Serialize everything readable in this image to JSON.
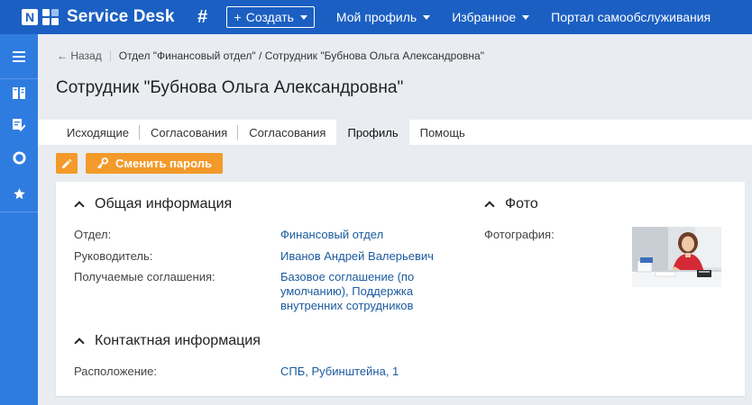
{
  "header": {
    "logo_letter": "N",
    "app_name": "Service Desk",
    "create_label": "Создать",
    "nav": [
      {
        "label": "Мой профиль"
      },
      {
        "label": "Избранное"
      },
      {
        "label": "Портал самообслуживания"
      }
    ]
  },
  "breadcrumb": {
    "back_label": "Назад",
    "path": "Отдел \"Финансовый отдел\" / Сотрудник \"Бубнова Ольга Александровна\""
  },
  "page": {
    "title": "Сотрудник \"Бубнова Ольга Александровна\""
  },
  "tabs": [
    {
      "label": "Исходящие"
    },
    {
      "label": "Согласования"
    },
    {
      "label": "Согласования"
    },
    {
      "label": "Профиль",
      "active": true
    },
    {
      "label": "Помощь"
    }
  ],
  "toolbar": {
    "change_password_label": "Сменить пароль"
  },
  "general": {
    "title": "Общая информация",
    "fields": [
      {
        "label": "Отдел:",
        "value": "Финансовый отдел"
      },
      {
        "label": "Руководитель:",
        "value": "Иванов Андрей Валерьевич"
      },
      {
        "label": "Получаемые соглашения:",
        "value_lines": [
          "Базовое соглашение (по",
          "умолчанию), Поддержка",
          "внутренних сотрудников"
        ]
      }
    ]
  },
  "contact": {
    "title": "Контактная информация",
    "fields": [
      {
        "label": "Расположение:",
        "value": "СПБ, Рубинштейна, 1"
      }
    ]
  },
  "photo_section": {
    "title": "Фото",
    "label": "Фотография:"
  },
  "colors": {
    "header_bg": "#1b5fc2",
    "sidebar_bg": "#2f7ce0",
    "accent_orange": "#f39a2b",
    "link": "#1a5a9e"
  }
}
